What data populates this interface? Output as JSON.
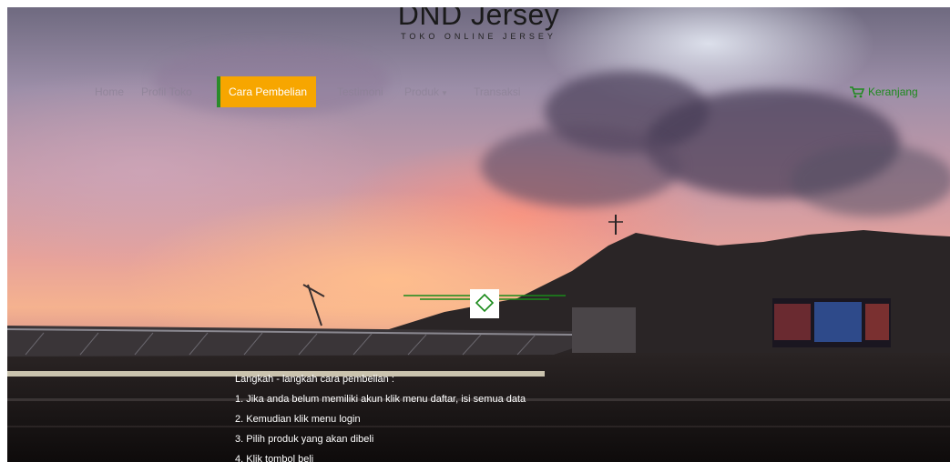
{
  "brand": {
    "title": "DND Jersey",
    "tagline": "TOKO ONLINE JERSEY"
  },
  "nav": {
    "items": [
      {
        "label": "Home"
      },
      {
        "label": "Profil Toko"
      },
      {
        "label": "Cara Pembelian",
        "active": true
      },
      {
        "label": "Testimoni"
      },
      {
        "label": "Produk",
        "has_dropdown": true
      },
      {
        "label": "Transaksi"
      }
    ],
    "cart_label": "Keranjang"
  },
  "content": {
    "heading": "Langkah - langkah cara pembelian :",
    "steps": [
      "1. Jika anda belum memiliki akun klik menu daftar, isi semua data",
      "2. Kemudian klik menu login",
      "3. Pilih produk yang akan dibeli",
      "4. Klik tombol beli"
    ]
  },
  "colors": {
    "active_nav_bg": "#f7a600",
    "active_nav_border": "#2a8b2a",
    "cart_color": "#1e8a1e",
    "divider_line": "#1a8a1a"
  },
  "icons": {
    "cart": "shopping-cart-icon",
    "divider": "diamond-icon",
    "dropdown": "caret-down-icon"
  }
}
